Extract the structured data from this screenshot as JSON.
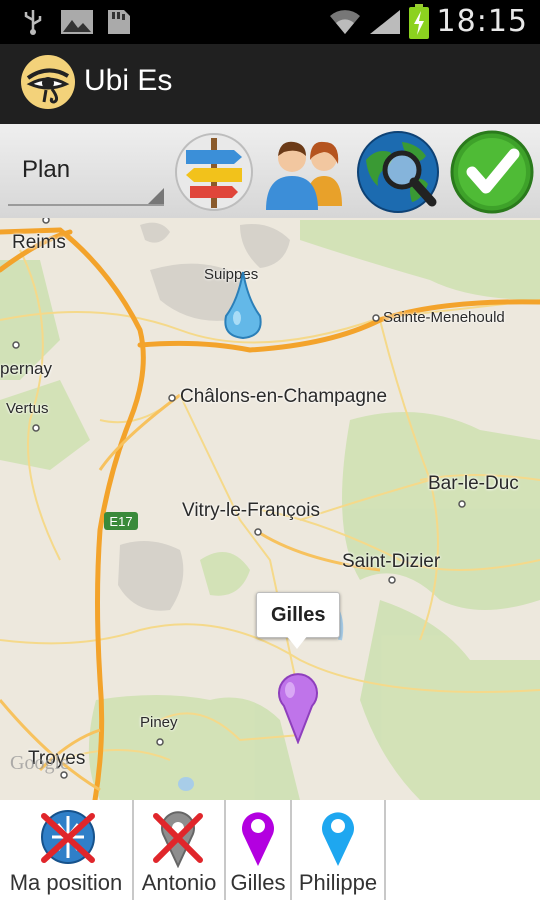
{
  "status_bar": {
    "time": "18:15",
    "icons": [
      "usb-icon",
      "picture-icon",
      "sd-card-icon",
      "wifi-icon",
      "signal-icon",
      "battery-charging-icon"
    ]
  },
  "app": {
    "title": "Ubi Es",
    "logo_icon": "eye-of-horus-icon",
    "colors": {
      "action_bar": "#202020",
      "toolbar": "#e6e6e6"
    }
  },
  "toolbar": {
    "map_type_selected": "Plan",
    "buttons": [
      "signpost-icon",
      "people-icon",
      "globe-search-icon",
      "checkmark-icon"
    ]
  },
  "map": {
    "places": [
      "Reims",
      "Suippes",
      "Sainte-Menehould",
      "pernay",
      "Vertus",
      "Châlons-en-Champagne",
      "Bar-le-Duc",
      "Vitry-le-François",
      "Saint-Dizier",
      "Piney",
      "Troyes"
    ],
    "road_label": "E17",
    "callout": "Gilles",
    "watermark": "Google",
    "marker_colors": {
      "blue": "#5ab4e8",
      "purple": "#b96ce8"
    }
  },
  "bottom_tabs": [
    {
      "label": "Ma position",
      "icon": "globe-crossed-icon"
    },
    {
      "label": "Antonio",
      "icon": "gray-pin-crossed-icon"
    },
    {
      "label": "Gilles",
      "icon": "purple-pin-icon"
    },
    {
      "label": "Philippe",
      "icon": "blue-pin-icon"
    }
  ]
}
